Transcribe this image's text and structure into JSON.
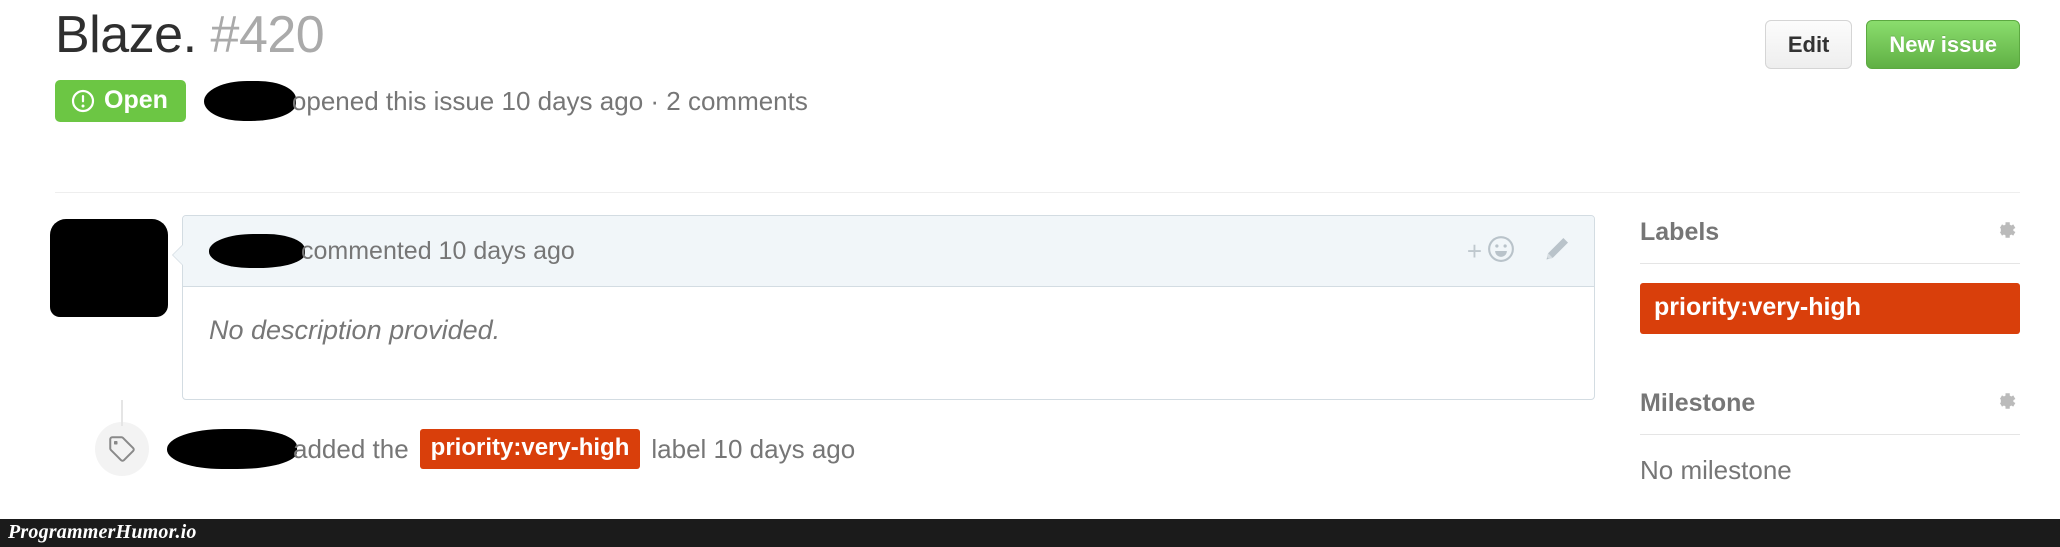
{
  "issue": {
    "title": "Blaze.",
    "number": "#420",
    "state_label": "Open",
    "meta_text": "opened this issue 10 days ago · 2 comments",
    "author_redacted": true
  },
  "header_actions": {
    "edit_label": "Edit",
    "new_issue_label": "New issue"
  },
  "comment": {
    "meta_text": "commented 10 days ago",
    "body_text": "No description provided.",
    "reaction_plus": "+",
    "reaction_icon": "smiley-icon",
    "edit_icon": "pencil-icon",
    "avatar_redacted": true
  },
  "timeline_event": {
    "icon": "tag-icon",
    "action_text": "added the",
    "label_text": "priority:very-high",
    "suffix_text": "label 10 days ago"
  },
  "sidebar": {
    "labels": {
      "title": "Labels",
      "settings_icon": "gear-icon",
      "items": [
        {
          "name": "priority:very-high",
          "color": "#d93f0b"
        }
      ]
    },
    "milestone": {
      "title": "Milestone",
      "settings_icon": "gear-icon",
      "empty_text": "No milestone"
    }
  },
  "watermark": {
    "text": "ProgrammerHumor.io"
  },
  "colors": {
    "open_green": "#6cc644",
    "button_green": "#60b044",
    "label_red": "#d93f0b",
    "comment_header_bg": "#f1f6f9",
    "comment_border": "#d3dce2",
    "muted_text": "#767676"
  }
}
